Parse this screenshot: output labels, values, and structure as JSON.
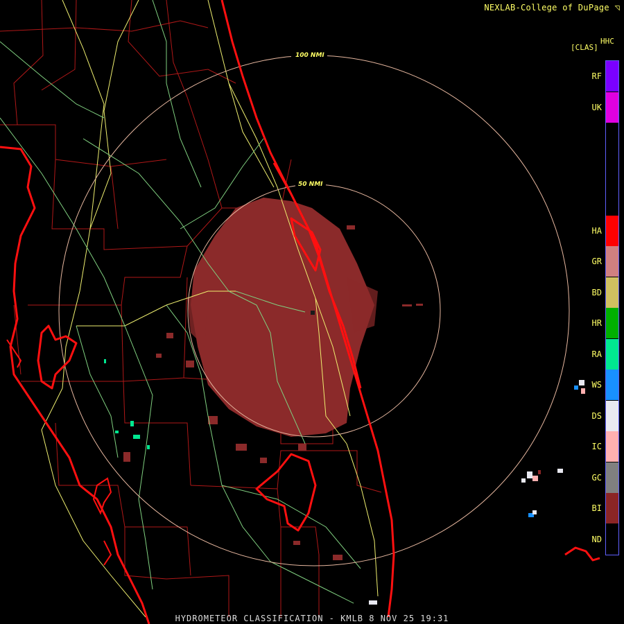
{
  "header": {
    "credit": "NEXLAB-College of DuPage",
    "credit_mark": "◹",
    "product_code": "HHC",
    "product_unit": "[CLAS]"
  },
  "rings": [
    {
      "label": "100 NMI"
    },
    {
      "label": "50 NMI"
    }
  ],
  "legend": [
    {
      "code": "RF",
      "color": "#7b00ff"
    },
    {
      "code": "UK",
      "color": "#e000e0"
    },
    {
      "code": "",
      "color": "#000000"
    },
    {
      "code": "",
      "color": "#000000"
    },
    {
      "code": "",
      "color": "#000000"
    },
    {
      "code": "HA",
      "color": "#ff0000"
    },
    {
      "code": "GR",
      "color": "#d08080"
    },
    {
      "code": "BD",
      "color": "#d0c060"
    },
    {
      "code": "HR",
      "color": "#00b000"
    },
    {
      "code": "RA",
      "color": "#00e890"
    },
    {
      "code": "WS",
      "color": "#1890ff"
    },
    {
      "code": "DS",
      "color": "#e8e8f0"
    },
    {
      "code": "IC",
      "color": "#ffb0b0"
    },
    {
      "code": "GC",
      "color": "#808080"
    },
    {
      "code": "BI",
      "color": "#8b2525"
    },
    {
      "code": "ND",
      "color": "#000000"
    }
  ],
  "colors": {
    "coast": "#ff1010",
    "county": "#b01818",
    "highway": "#f0f070",
    "road": "#80d080",
    "ring": "#e8b8a0",
    "echo": "#8b2a2a"
  },
  "footer": {
    "title": "HYDROMETEOR CLASSIFICATION - KMLB 8 NOV 25 19:31"
  }
}
